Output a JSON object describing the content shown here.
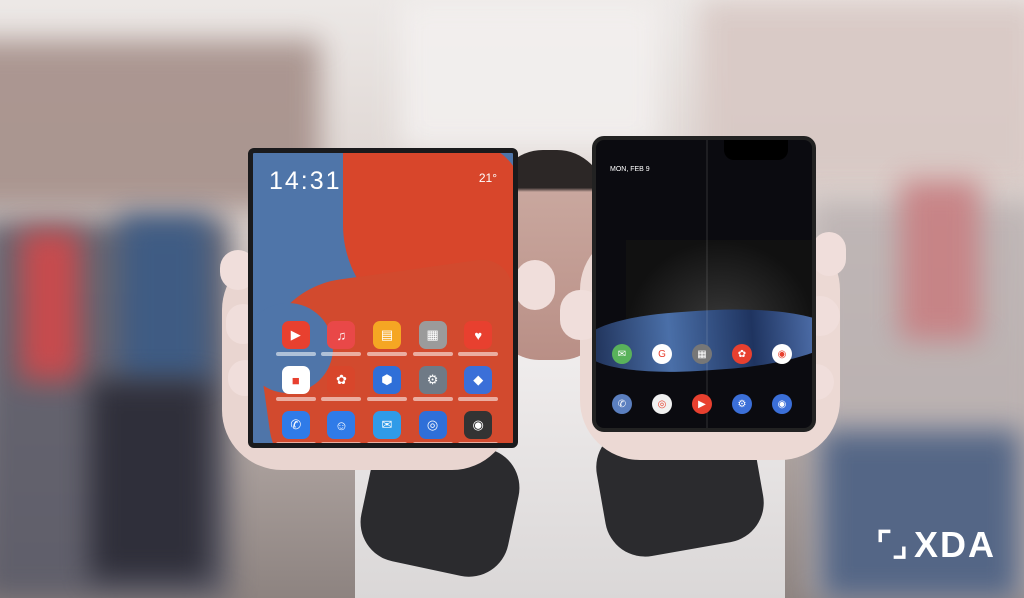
{
  "photo": {
    "description_icon": "photo-scene",
    "left_phone": {
      "clock": "14:31",
      "weather": "21°",
      "apps": [
        {
          "icon": "video-icon",
          "glyph": "▶",
          "color": "#e8402f"
        },
        {
          "icon": "music-icon",
          "glyph": "♫",
          "color": "#e94848"
        },
        {
          "icon": "books-icon",
          "glyph": "▤",
          "color": "#f5a623"
        },
        {
          "icon": "gallery-icon",
          "glyph": "▦",
          "color": "#9b9b9b"
        },
        {
          "icon": "health-icon",
          "glyph": "♥",
          "color": "#e8402f"
        },
        {
          "icon": "store-icon",
          "glyph": "■",
          "color": "#ffffff"
        },
        {
          "icon": "huawei-icon",
          "glyph": "✿",
          "color": "#d8462b"
        },
        {
          "icon": "security-icon",
          "glyph": "⬢",
          "color": "#2f6fd8"
        },
        {
          "icon": "settings-icon",
          "glyph": "⚙",
          "color": "#6f7a86"
        },
        {
          "icon": "themes-icon",
          "glyph": "◆",
          "color": "#3b6fd8"
        },
        {
          "icon": "phone-icon",
          "glyph": "✆",
          "color": "#2f7be8"
        },
        {
          "icon": "contacts-icon",
          "glyph": "☺",
          "color": "#2f7be8"
        },
        {
          "icon": "messages-icon",
          "glyph": "✉",
          "color": "#2f9be8"
        },
        {
          "icon": "browser-icon",
          "glyph": "◎",
          "color": "#2f6fd8"
        },
        {
          "icon": "camera-icon",
          "glyph": "◉",
          "color": "#333"
        }
      ]
    },
    "right_phone": {
      "date": "MON, FEB 9",
      "dock": [
        {
          "icon": "wechat-icon",
          "glyph": "✉",
          "color": "#59b25b",
          "label": "WeChat"
        },
        {
          "icon": "google-icon",
          "glyph": "G",
          "color": "#ffffff",
          "label": "Google"
        },
        {
          "icon": "folder-icon",
          "glyph": "▦",
          "color": "#777"
        },
        {
          "icon": "gallery-icon",
          "glyph": "✿",
          "color": "#e8402f"
        },
        {
          "icon": "camera-icon",
          "glyph": "◉",
          "color": "#fff"
        }
      ],
      "hotseat": [
        {
          "icon": "phone-icon",
          "glyph": "✆",
          "color": "#5b7fbf"
        },
        {
          "icon": "chrome-icon",
          "glyph": "◎",
          "color": "#f1f1f1"
        },
        {
          "icon": "youtube-icon",
          "glyph": "▶",
          "color": "#e8402f"
        },
        {
          "icon": "settings-icon",
          "glyph": "⚙",
          "color": "#3b6fd8"
        },
        {
          "icon": "camera-icon",
          "glyph": "◉",
          "color": "#3b6fd8"
        }
      ]
    },
    "watermark": {
      "logo_text": "XDA",
      "mark_glyph": "[\\"
    }
  }
}
